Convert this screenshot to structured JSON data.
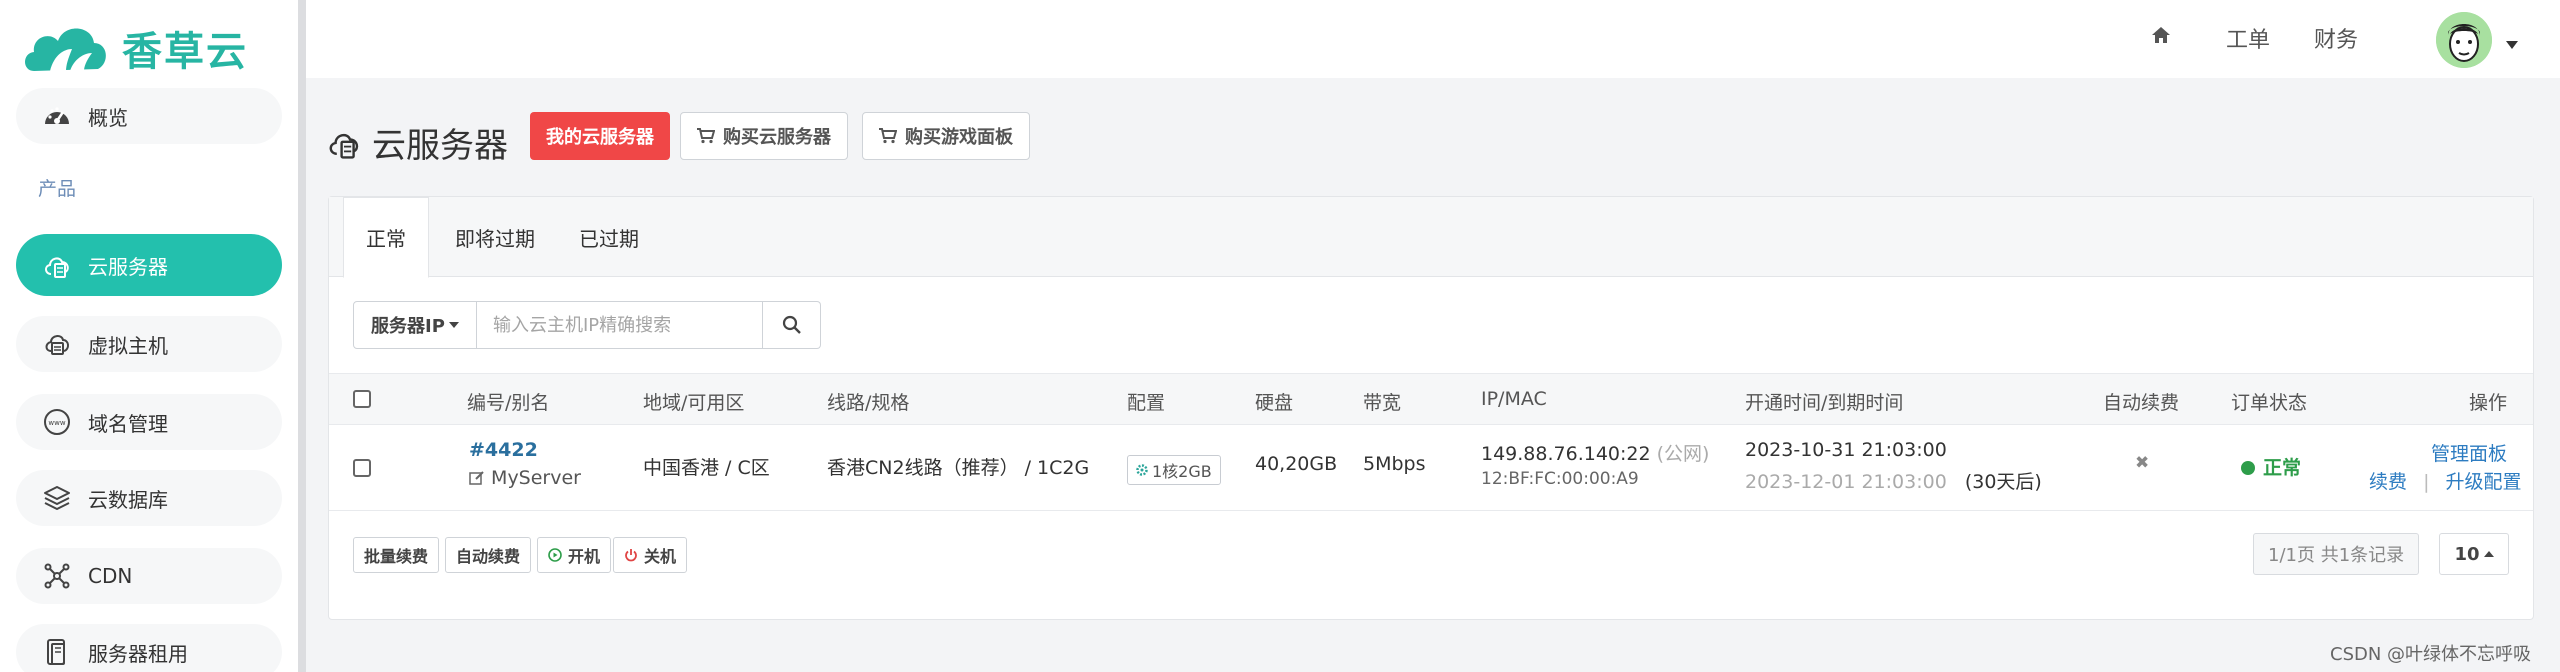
{
  "brand": {
    "name": "香草云",
    "color": "#27b5a3"
  },
  "sidebar": {
    "items": [
      {
        "label": "概览",
        "icon": "dashboard-icon"
      },
      {
        "label": "云服务器",
        "icon": "cloud-server-icon",
        "active": true
      },
      {
        "label": "虚拟主机",
        "icon": "virtual-host-icon"
      },
      {
        "label": "域名管理",
        "icon": "domain-icon"
      },
      {
        "label": "云数据库",
        "icon": "database-icon"
      },
      {
        "label": "CDN",
        "icon": "cdn-icon"
      },
      {
        "label": "服务器租用",
        "icon": "server-rental-icon"
      }
    ],
    "section_products": "产品",
    "active_color": "#23c0ad"
  },
  "header": {
    "home_icon": "home-icon",
    "ticket_label": "工单",
    "finance_label": "财务",
    "avatar_icon": "avatar-icon"
  },
  "page": {
    "title": "云服务器",
    "btn_my_servers": "我的云服务器",
    "btn_buy_server": "购买云服务器",
    "btn_buy_panel": "购买游戏面板"
  },
  "tabs": [
    "正常",
    "即将过期",
    "已过期"
  ],
  "search": {
    "select_label": "服务器IP",
    "placeholder": "输入云主机IP精确搜索"
  },
  "table": {
    "headers": [
      "编号/别名",
      "地域/可用区",
      "线路/规格",
      "配置",
      "硬盘",
      "带宽",
      "IP/MAC",
      "开通时间/到期时间",
      "自动续费",
      "订单状态",
      "操作"
    ],
    "rows": [
      {
        "id": "#4422",
        "alias": "MyServer",
        "region": "中国香港 / C区",
        "line": "香港CN2线路（推荐） / 1C2G",
        "config": "1核2GB",
        "disk": "40,20GB",
        "bandwidth": "5Mbps",
        "ip": "149.88.76.140:22",
        "ip_tag": "(公网)",
        "mac": "12:BF:FC:00:00:A9",
        "open_time": "2023-10-31 21:03:00",
        "expire_time": "2023-12-01 21:03:00",
        "expire_hint": "(30天后)",
        "auto_renew": "✖",
        "status": "正常",
        "status_color": "#2e9d4a",
        "op_manage": "管理面板",
        "op_renew": "续费",
        "op_sep": "|",
        "op_upgrade": "升级配置"
      }
    ]
  },
  "footer": {
    "batch_renew": "批量续费",
    "auto_renew": "自动续费",
    "power_on": "开机",
    "power_off": "关机",
    "pager_info": "1/1页 共1条记录",
    "page_size": "10"
  },
  "watermark": "CSDN @叶绿体不忘呼吸"
}
